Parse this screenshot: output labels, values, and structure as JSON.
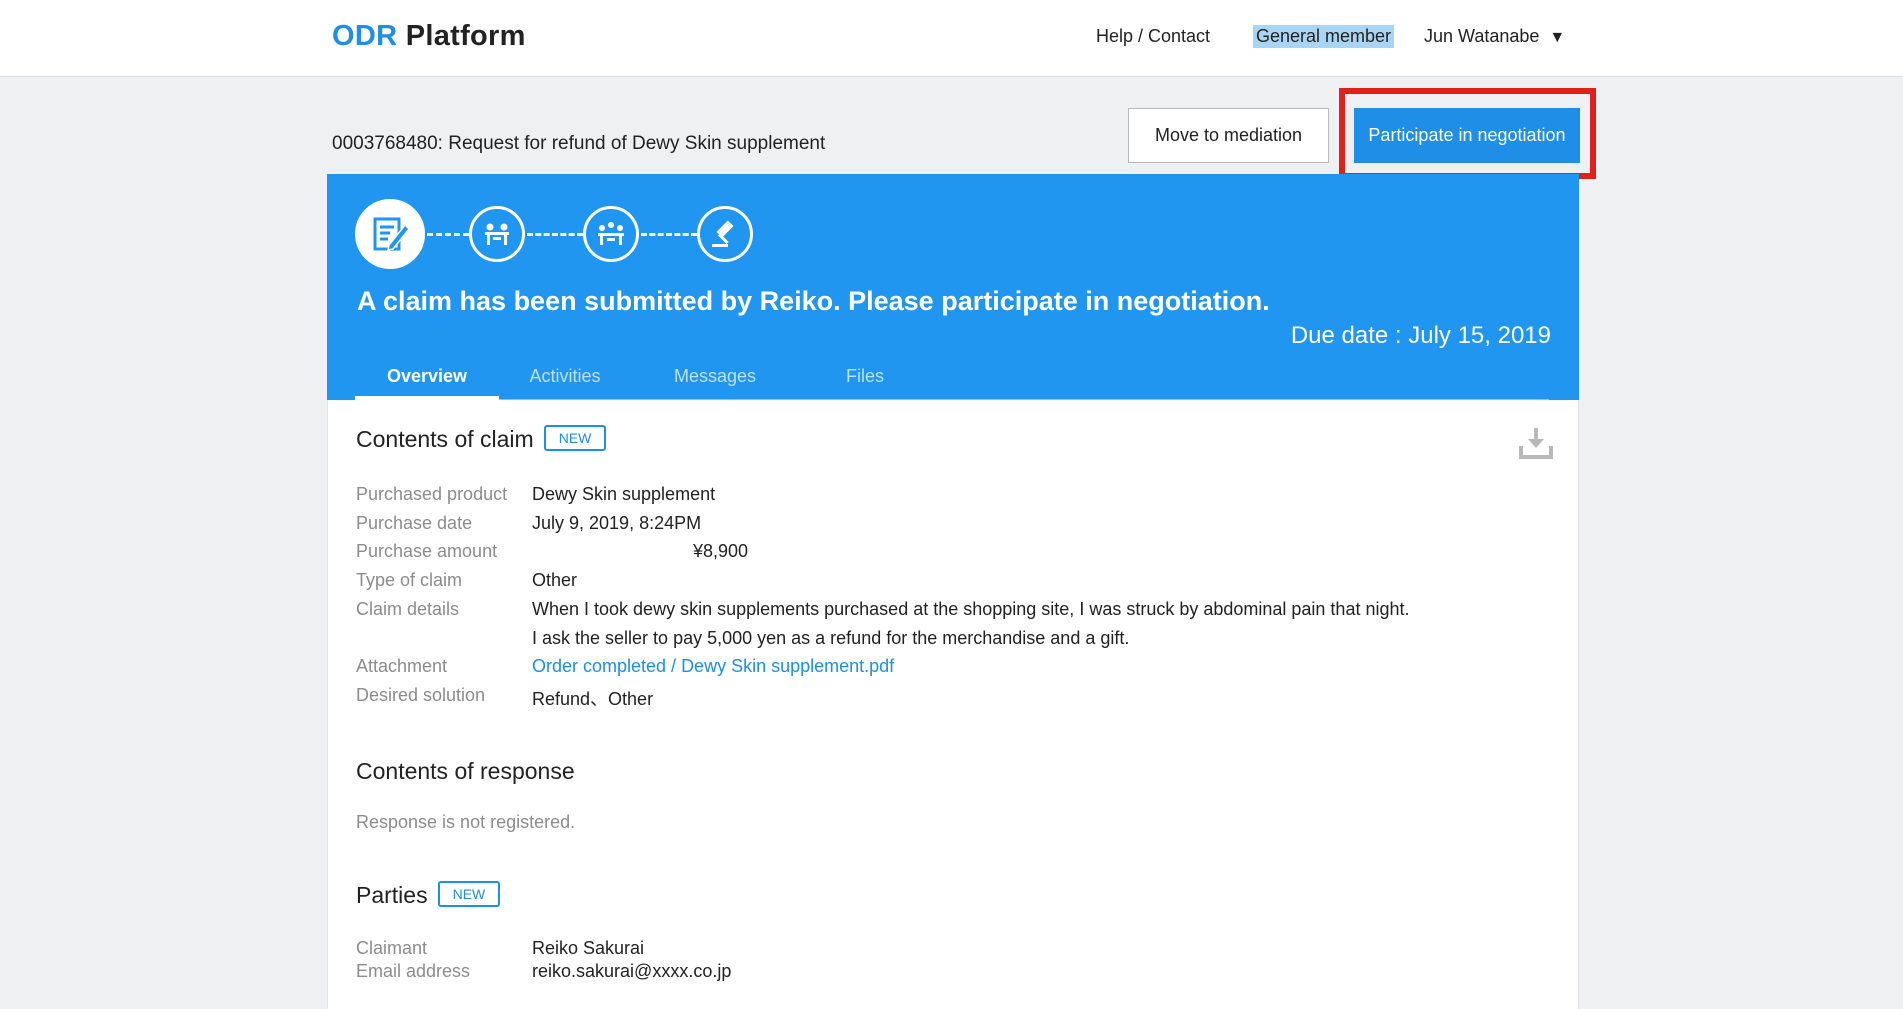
{
  "brand": {
    "odr": "ODR",
    "platform": "Platform"
  },
  "topnav": {
    "help_contact": "Help / Contact",
    "member_type": "General member",
    "user_name": "Jun Watanabe",
    "caret": "▼"
  },
  "case": {
    "title": "0003768480: Request for refund of Dewy Skin supplement",
    "move_to_mediation": "Move to mediation",
    "participate_in_negotiation": "Participate in negotiation"
  },
  "header": {
    "message": "A claim has been submitted by Reiko. Please participate in negotiation.",
    "due_date": "Due date : July 15, 2019"
  },
  "tabs": [
    {
      "label": "Overview",
      "active": true
    },
    {
      "label": "Activities",
      "active": false
    },
    {
      "label": "Messages",
      "active": false
    },
    {
      "label": "Files",
      "active": false
    }
  ],
  "claim": {
    "section_title": "Contents of claim",
    "badge": "NEW",
    "fields": [
      {
        "label": "Purchased product",
        "value": "Dewy Skin supplement"
      },
      {
        "label": "Purchase date",
        "value": "July 9, 2019, 8:24PM"
      },
      {
        "label": "Purchase amount",
        "value": "¥8,900"
      },
      {
        "label": "Type of claim",
        "value": "Other"
      },
      {
        "label": "Claim details",
        "value": "When I took dewy skin supplements purchased at the shopping site, I was struck by abdominal pain that night.",
        "value2": "I ask the seller to pay 5,000 yen as a refund for the merchandise and a gift."
      },
      {
        "label": "Attachment",
        "value": "Order completed / Dewy Skin supplement.pdf"
      },
      {
        "label": "Desired solution",
        "value": "Refund、Other"
      }
    ]
  },
  "response": {
    "section_title": "Contents of response",
    "empty_text": "Response is not registered."
  },
  "parties": {
    "section_title": "Parties",
    "badge": "NEW",
    "fields": [
      {
        "label": "Claimant",
        "value": "Reiko Sakurai"
      },
      {
        "label": "Email address",
        "value": "reiko.sakurai@xxxx.co.jp"
      }
    ]
  },
  "colors": {
    "brand_blue": "#1e8ee6",
    "header_blue": "#2196f0",
    "highlight_red": "#e0201c",
    "member_highlight": "#a9d5f5"
  },
  "icons": [
    "claim-document-icon",
    "negotiation-icon",
    "mediation-icon",
    "gavel-icon",
    "download-icon"
  ]
}
